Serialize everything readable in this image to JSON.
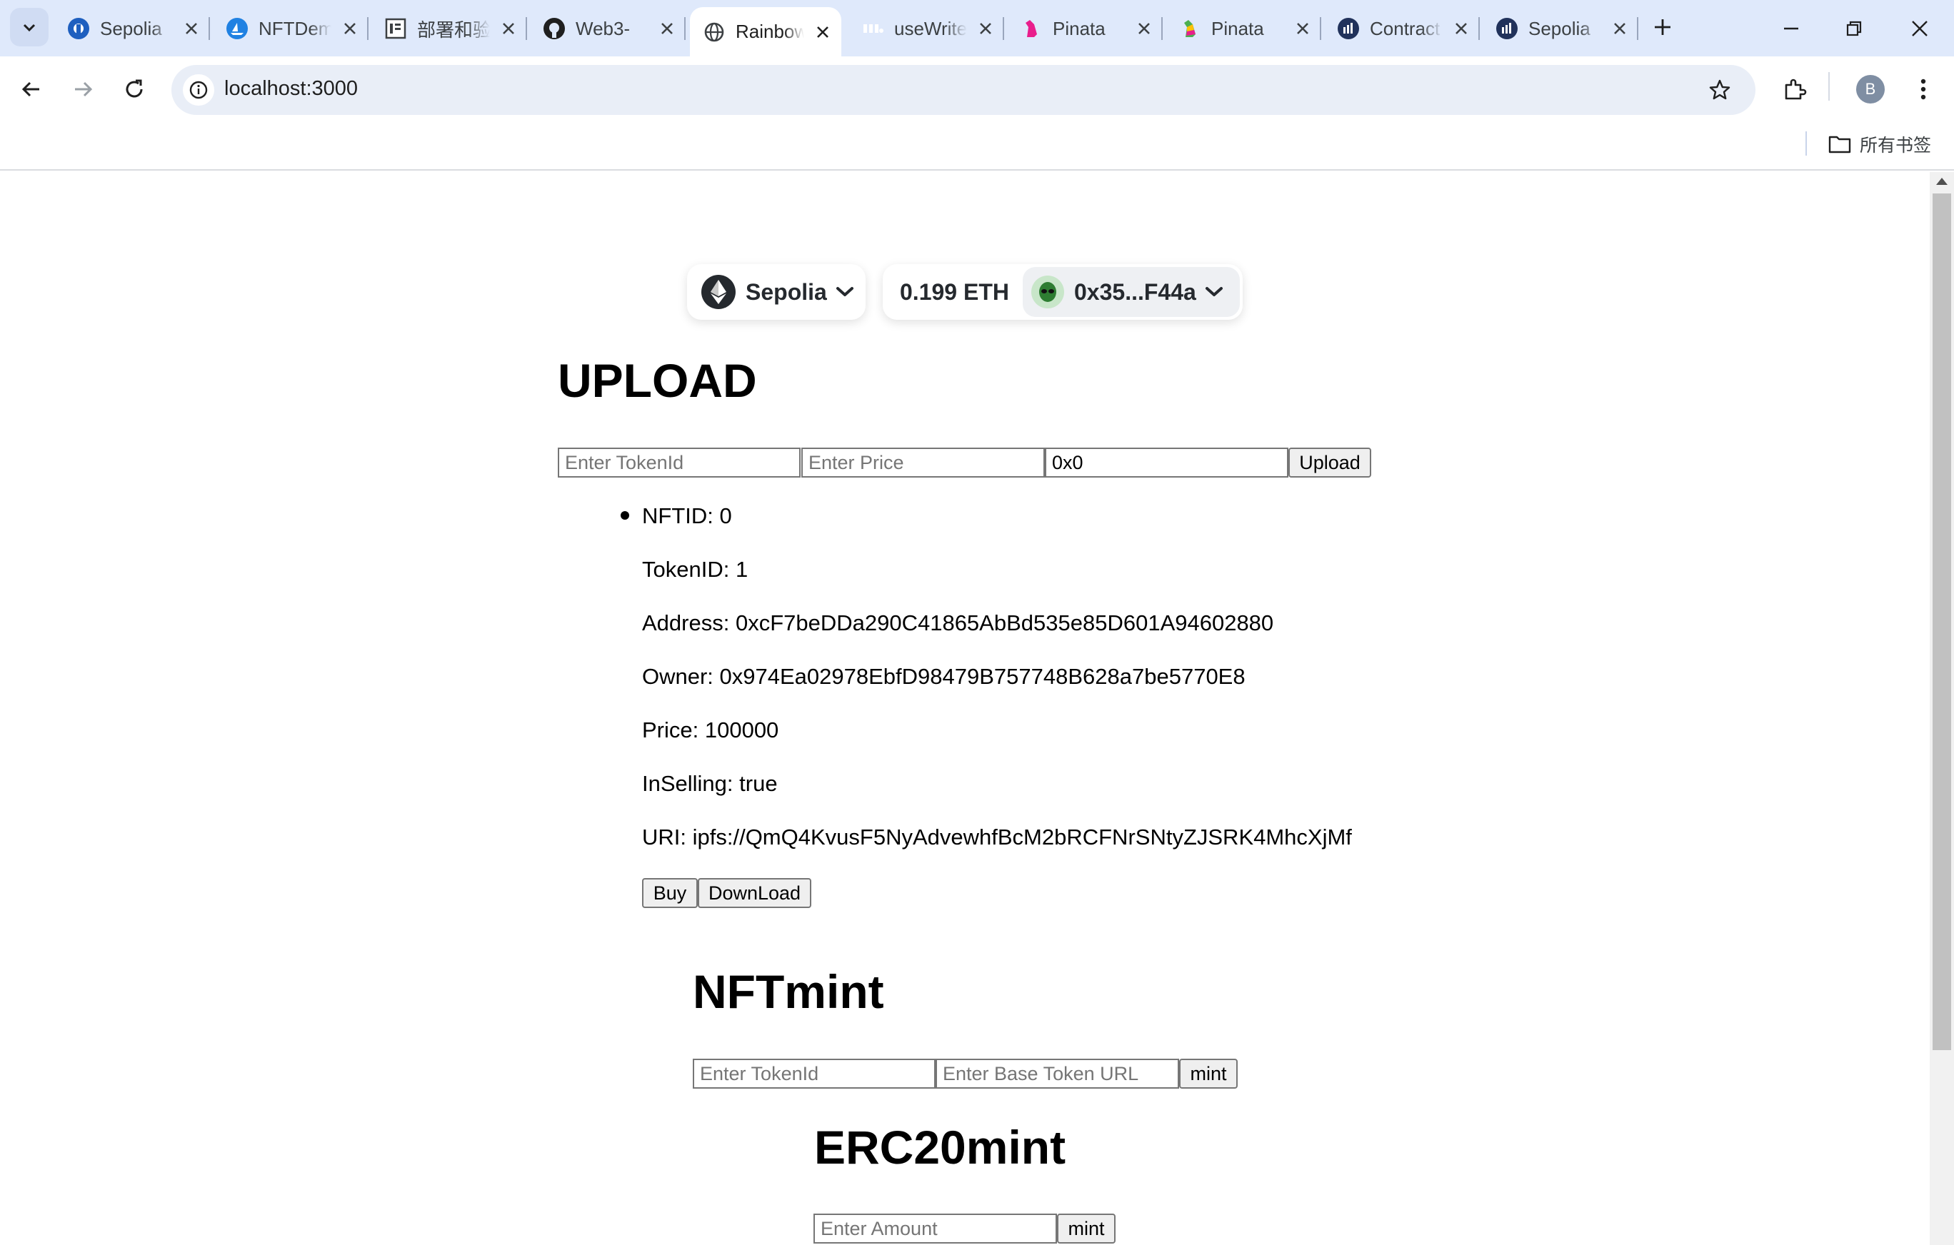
{
  "browser": {
    "tabs": [
      {
        "title": "Sepolia",
        "icon": "etherscan-icon"
      },
      {
        "title": "NFTDemo",
        "icon": "opensea-icon"
      },
      {
        "title": "部署和验证",
        "icon": "doc-icon"
      },
      {
        "title": "Web3-",
        "icon": "github-icon"
      },
      {
        "title": "Rainbow",
        "icon": "globe-icon",
        "active": true
      },
      {
        "title": "useWrite",
        "icon": "wagmi-icon"
      },
      {
        "title": "Pinata",
        "icon": "pinata-icon"
      },
      {
        "title": "Pinata",
        "icon": "pinata-icon"
      },
      {
        "title": "Contract",
        "icon": "etherscan-icon"
      },
      {
        "title": "Sepolia",
        "icon": "etherscan-icon"
      }
    ],
    "url": "localhost:3000",
    "profile_initial": "B",
    "bookmarks_label": "所有书签"
  },
  "wallet": {
    "chain": "Sepolia",
    "balance": "0.199 ETH",
    "account": "0x35...F44a"
  },
  "upload": {
    "heading": "UPLOAD",
    "token_placeholder": "Enter TokenId",
    "price_placeholder": "Enter Price",
    "address_value": "0x0",
    "button": "Upload"
  },
  "nft": {
    "nftid": "NFTID: 0",
    "tokenid": "TokenID: 1",
    "address": "Address: 0xcF7beDDa290C41865AbBd535e85D601A94602880",
    "owner": "Owner: 0x974Ea02978EbfD98479B757748B628a7be5770E8",
    "price": "Price: 100000",
    "inselling": "InSelling: true",
    "uri": "URI: ipfs://QmQ4KvusF5NyAdvewhfBcM2bRCFNrSNtyZJSRK4MhcXjMf",
    "buy": "Buy",
    "download": "DownLoad"
  },
  "nftmint": {
    "heading": "NFTmint",
    "token_placeholder": "Enter TokenId",
    "url_placeholder": "Enter Base Token URL",
    "button": "mint"
  },
  "erc20mint": {
    "heading": "ERC20mint",
    "amount_placeholder": "Enter Amount",
    "button": "mint"
  }
}
